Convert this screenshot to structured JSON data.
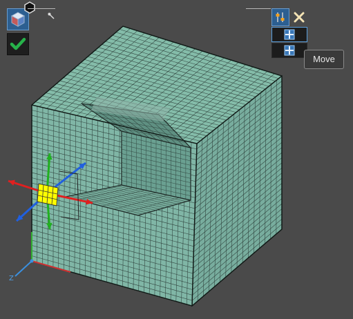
{
  "tooltip": {
    "text": "Move"
  },
  "colors": {
    "background": "#4a4a4a",
    "mesh_fill": "#7fb3a6",
    "mesh_line": "#1f2a27",
    "gizmo_x": "#e02020",
    "gizmo_y": "#20b020",
    "gizmo_z": "#2060e0",
    "handle": "#ffff00",
    "accent": "#2c5f91"
  },
  "icons": {
    "view_cube": "view-cube-icon",
    "accept": "checkmark-icon",
    "hex": "hexagon-icon",
    "pin": "pin-icon",
    "settings": "settings-sliders-icon",
    "close": "close-icon",
    "move_mode_a": "move-cross-icon",
    "move_mode_b": "move-cross-icon"
  },
  "axes": {
    "z_label": "Z"
  },
  "mesh": {
    "shape": "hexahedral-mesh-block-with-cavity"
  }
}
